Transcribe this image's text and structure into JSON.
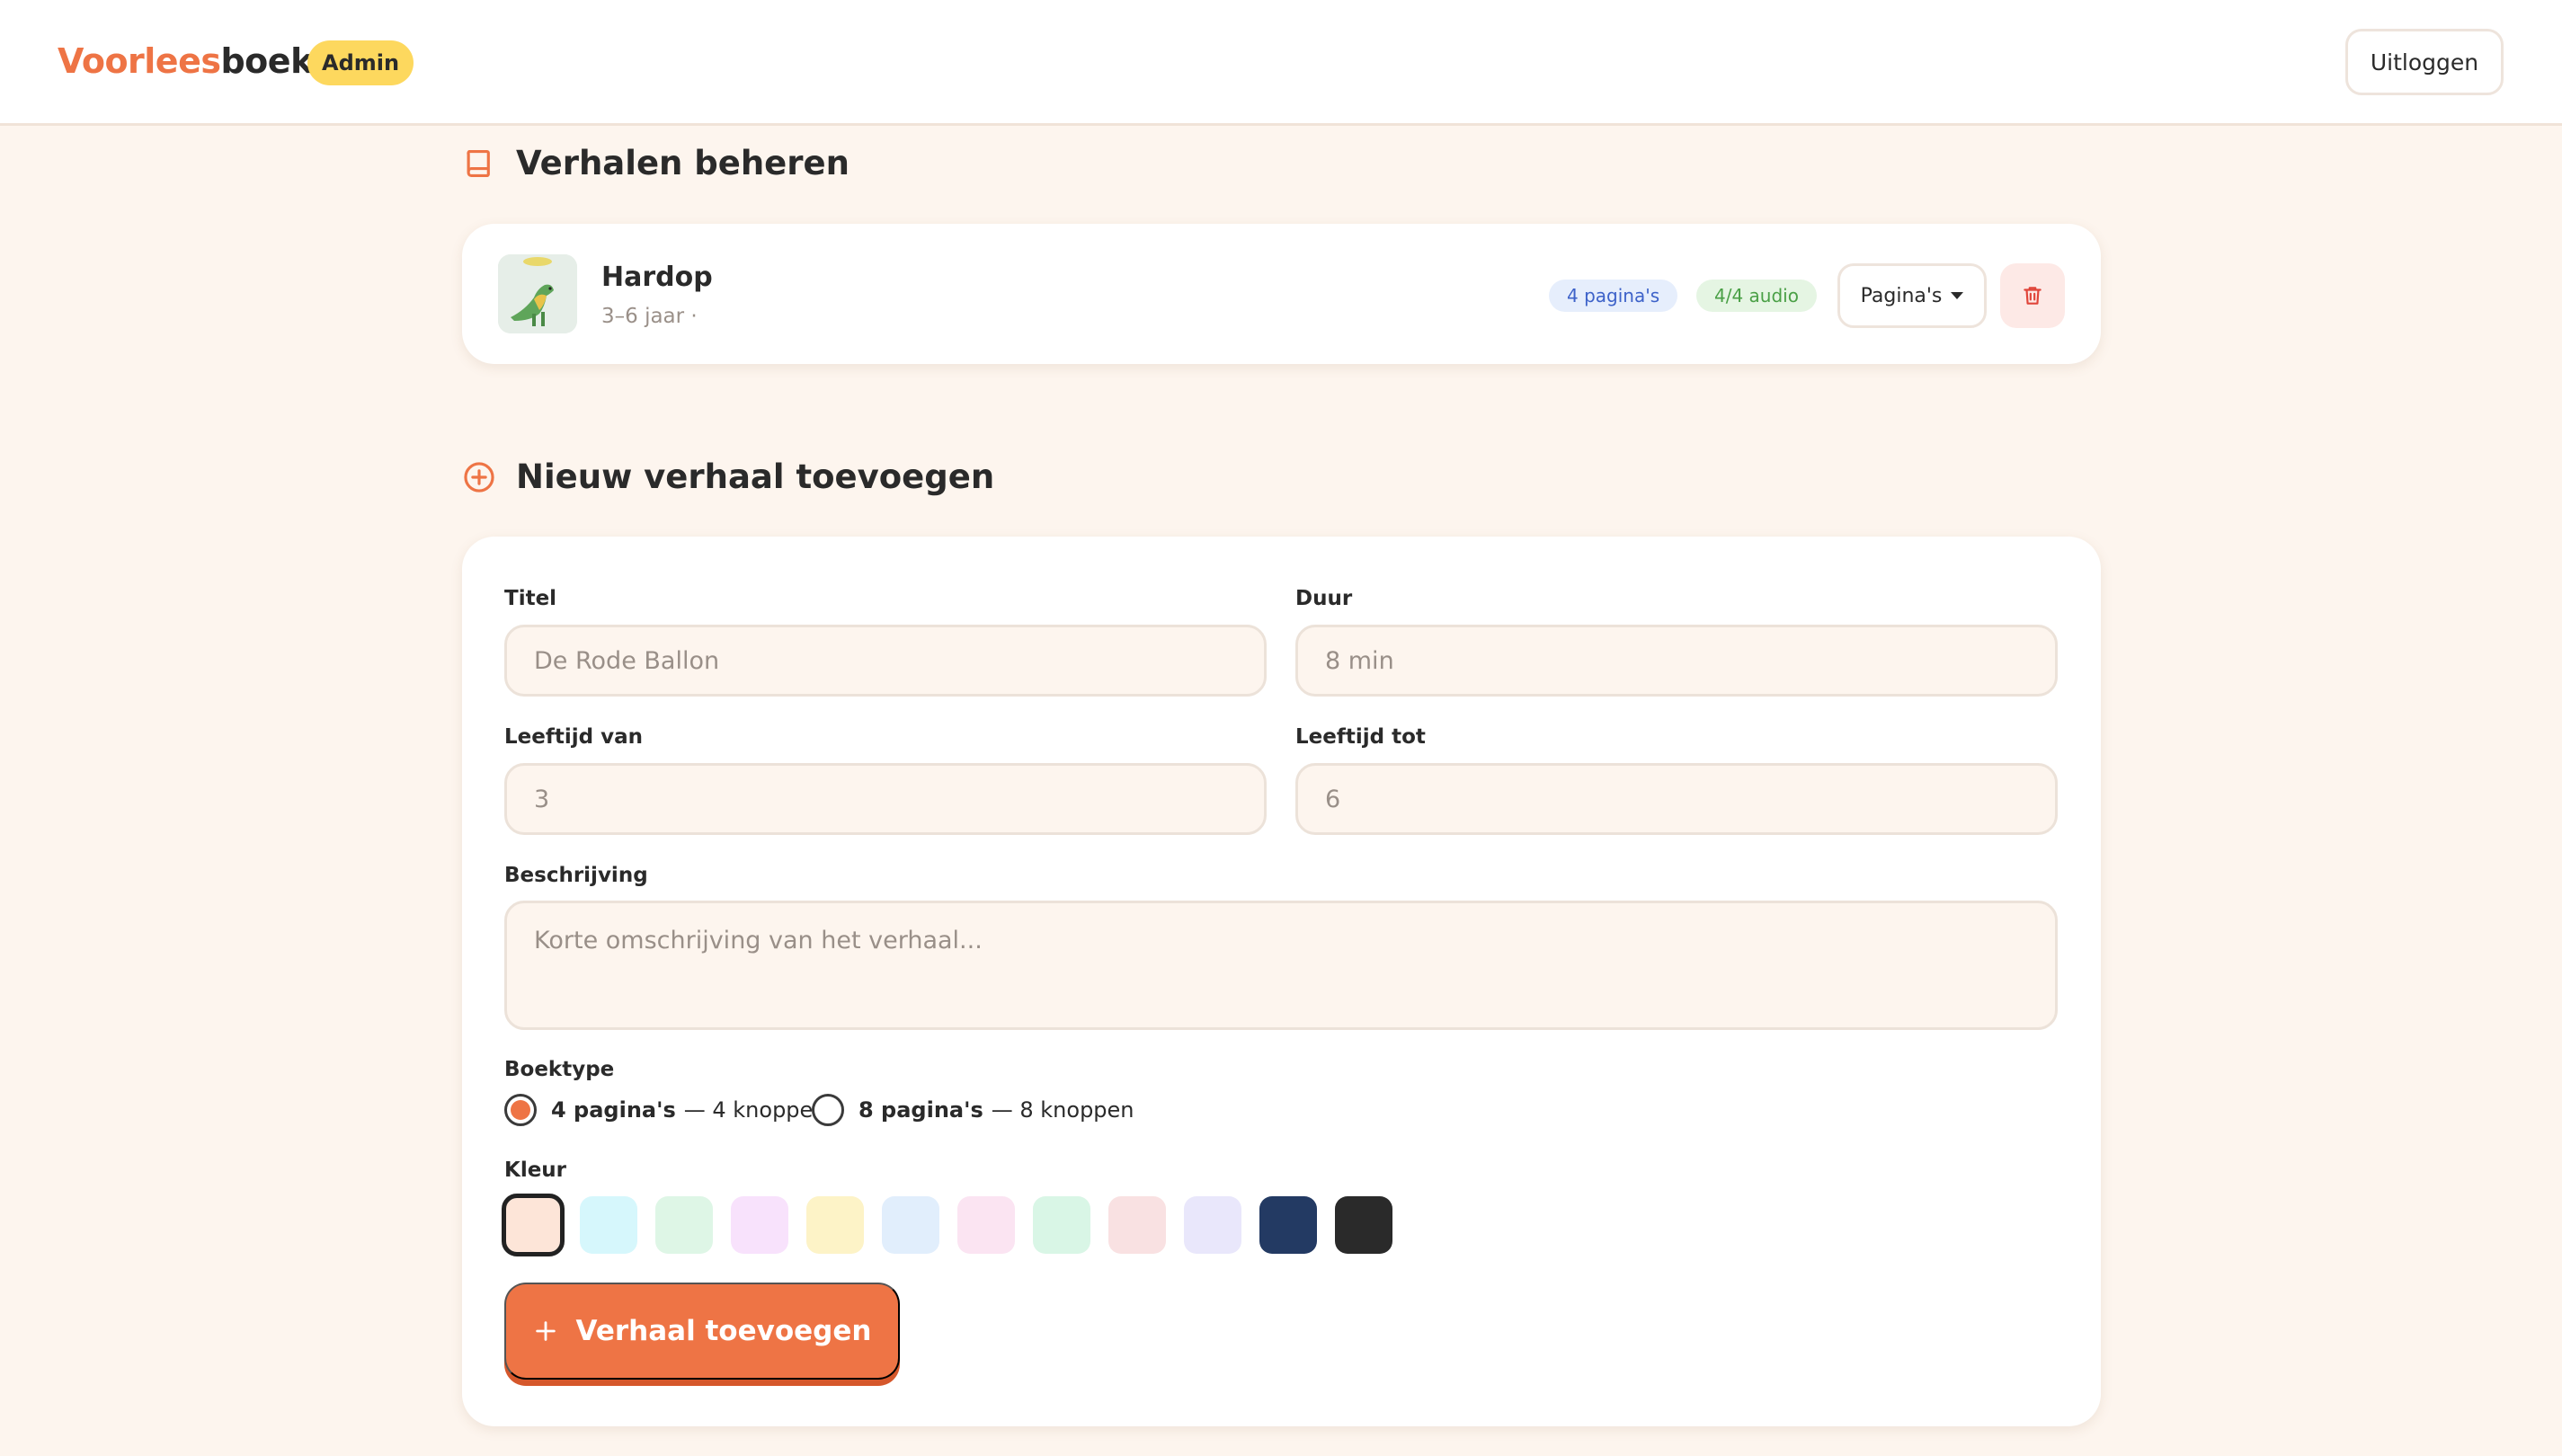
{
  "header": {
    "logo_part1": "Voorlees",
    "logo_part2": "boek",
    "badge": "Admin",
    "logout_label": "Uitloggen"
  },
  "manage": {
    "title": "Verhalen beheren",
    "stories": [
      {
        "title": "Hardop",
        "meta": "3–6 jaar ·",
        "pages_badge": "4 pagina's",
        "audio_badge": "4/4 audio",
        "pages_button": "Pagina's"
      }
    ]
  },
  "new_story": {
    "title": "Nieuw verhaal toevoegen",
    "fields": {
      "title_label": "Titel",
      "title_placeholder": "De Rode Ballon",
      "duration_label": "Duur",
      "duration_placeholder": "8 min",
      "age_from_label": "Leeftijd van",
      "age_from_placeholder": "3",
      "age_to_label": "Leeftijd tot",
      "age_to_placeholder": "6",
      "description_label": "Beschrijving",
      "description_placeholder": "Korte omschrijving van het verhaal..."
    },
    "booktype": {
      "label": "Boektype",
      "options": [
        {
          "bold": "4 pagina's",
          "rest": "— 4 knoppen",
          "checked": true
        },
        {
          "bold": "8 pagina's",
          "rest": "— 8 knoppen",
          "checked": false
        }
      ]
    },
    "color": {
      "label": "Kleur",
      "swatches": [
        "#fde5d8",
        "#d6f7fc",
        "#def6e6",
        "#f8e2fc",
        "#fdf3c7",
        "#e1eefc",
        "#fbe4f2",
        "#d9f6e6",
        "#f9e1e2",
        "#e9e7fb",
        "#233a63",
        "#2a2a2a"
      ],
      "selected_index": 0
    },
    "submit_label": "Verhaal toevoegen"
  },
  "colors": {
    "accent": "#ee7445",
    "background": "#fdf5ee"
  }
}
